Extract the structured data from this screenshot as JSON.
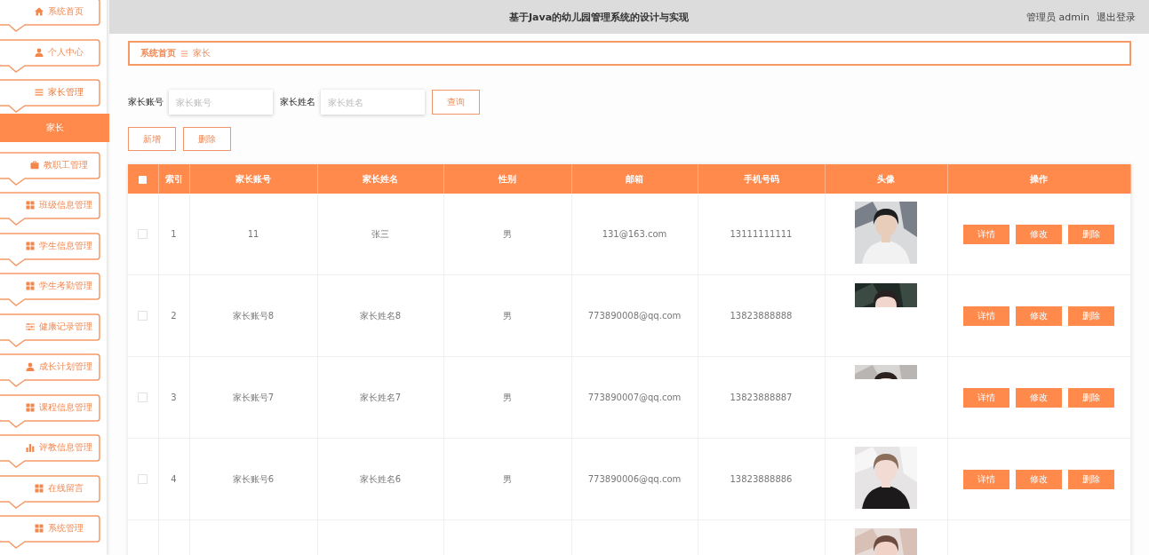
{
  "top_bar": {
    "title": "基于Java的幼儿园管理系统的设计与实现",
    "user": "管理员 admin",
    "logout": "退出登录"
  },
  "sidebar": {
    "items": [
      {
        "label": "系统首页",
        "kind": "home",
        "selected": false
      },
      {
        "label": "个人中心",
        "kind": "user",
        "selected": false
      },
      {
        "label": "家长管理",
        "kind": "list",
        "selected": false,
        "expanded": true,
        "children": [
          {
            "label": "家长",
            "selected": true
          }
        ]
      },
      {
        "label": "教职工管理",
        "kind": "briefcase",
        "selected": false
      },
      {
        "label": "班级信息管理",
        "kind": "grid",
        "selected": false
      },
      {
        "label": "学生信息管理",
        "kind": "grid",
        "selected": false
      },
      {
        "label": "学生考勤管理",
        "kind": "grid",
        "selected": false
      },
      {
        "label": "健康记录管理",
        "kind": "sliders",
        "selected": false
      },
      {
        "label": "成长计划管理",
        "kind": "user",
        "selected": false
      },
      {
        "label": "课程信息管理",
        "kind": "grid",
        "selected": false
      },
      {
        "label": "评教信息管理",
        "kind": "bars",
        "selected": false
      },
      {
        "label": "在线留言",
        "kind": "grid",
        "selected": false
      },
      {
        "label": "系统管理",
        "kind": "grid",
        "selected": false
      }
    ]
  },
  "breadcrumb": [
    "系统首页",
    "家长"
  ],
  "search": {
    "fields": [
      {
        "label": "家长账号",
        "placeholder": "家长账号"
      },
      {
        "label": "家长姓名",
        "placeholder": "家长姓名"
      }
    ],
    "button": "查询"
  },
  "actions": [
    "新增",
    "删除"
  ],
  "table": {
    "select_all": {
      "checked": false
    },
    "columns": [
      "索引",
      "家长账号",
      "家长姓名",
      "性别",
      "邮箱",
      "手机号码",
      "头像",
      "操作"
    ],
    "rows": [
      {
        "kind": "full",
        "checked": false,
        "index": "1",
        "account": "11",
        "name": "张三",
        "gender": "男",
        "email": "131@163.com",
        "phone": "13111111111",
        "actions": [
          "详情",
          "修改",
          "删除"
        ]
      },
      {
        "kind": "full",
        "checked": false,
        "index": "2",
        "account": "家长账号8",
        "name": "家长姓名8",
        "gender": "男",
        "email": "773890008@qq.com",
        "phone": "13823888888",
        "actions": [
          "详情",
          "修改",
          "删除"
        ]
      },
      {
        "kind": "full",
        "checked": false,
        "index": "3",
        "account": "家长账号7",
        "name": "家长姓名7",
        "gender": "男",
        "email": "773890007@qq.com",
        "phone": "13823888887",
        "actions": [
          "详情",
          "修改",
          "删除"
        ]
      },
      {
        "kind": "full",
        "checked": false,
        "index": "4",
        "account": "家长账号6",
        "name": "家长姓名6",
        "gender": "男",
        "email": "773890006@qq.com",
        "phone": "13823888886",
        "actions": [
          "详情",
          "修改",
          "删除"
        ]
      },
      {
        "kind": "cut"
      }
    ]
  }
}
